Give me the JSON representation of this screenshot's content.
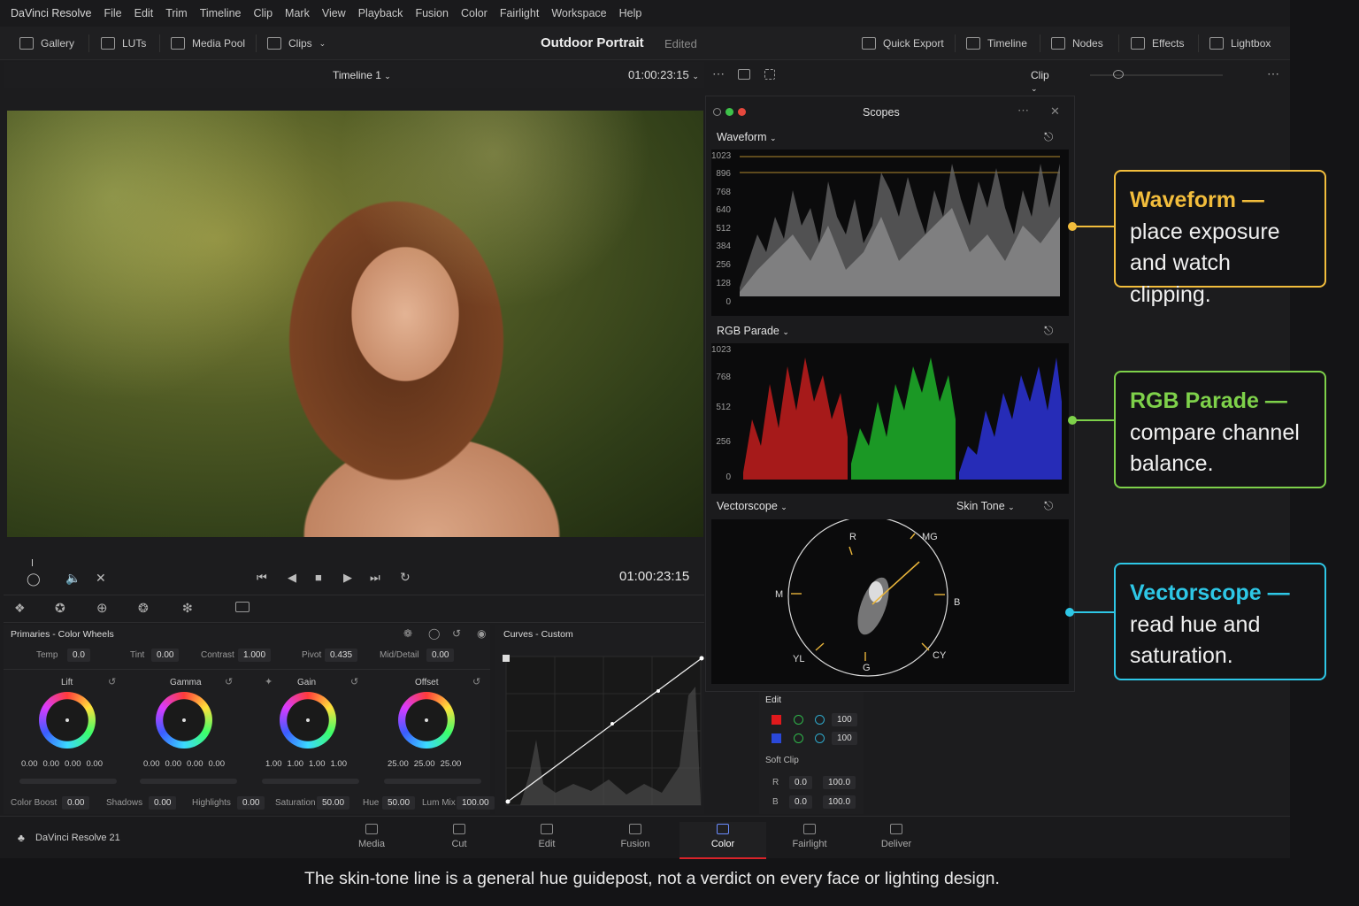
{
  "menubar": {
    "brand": "DaVinci Resolve",
    "items": [
      "File",
      "Edit",
      "Trim",
      "Timeline",
      "Clip",
      "Mark",
      "View",
      "Playback",
      "Fusion",
      "Color",
      "Fairlight",
      "Workspace",
      "Help"
    ]
  },
  "toolbar": {
    "left": [
      "Gallery",
      "LUTs",
      "Media Pool",
      "Clips"
    ],
    "project_title": "Outdoor Portrait",
    "project_state": "Edited",
    "right": [
      "Quick Export",
      "Timeline",
      "Nodes",
      "Effects",
      "Lightbox"
    ]
  },
  "viewer": {
    "timeline_name": "Timeline 1",
    "timecode": "01:00:23:15",
    "clip_mode": "Clip"
  },
  "transport": {
    "timecode": "01:00:23:15"
  },
  "primaries": {
    "title": "Primaries - Color Wheels",
    "top_params": [
      {
        "label": "Temp",
        "value": "0.0"
      },
      {
        "label": "Tint",
        "value": "0.00"
      },
      {
        "label": "Contrast",
        "value": "1.000"
      },
      {
        "label": "Pivot",
        "value": "0.435"
      },
      {
        "label": "Mid/Detail",
        "value": "0.00"
      }
    ],
    "wheels": [
      {
        "name": "Lift",
        "values": [
          "0.00",
          "0.00",
          "0.00",
          "0.00"
        ]
      },
      {
        "name": "Gamma",
        "values": [
          "0.00",
          "0.00",
          "0.00",
          "0.00"
        ]
      },
      {
        "name": "Gain",
        "values": [
          "1.00",
          "1.00",
          "1.00",
          "1.00"
        ]
      },
      {
        "name": "Offset",
        "values": [
          "25.00",
          "25.00",
          "25.00"
        ]
      }
    ],
    "bottom_params": [
      {
        "label": "Color Boost",
        "value": "0.00"
      },
      {
        "label": "Shadows",
        "value": "0.00"
      },
      {
        "label": "Highlights",
        "value": "0.00"
      },
      {
        "label": "Saturation",
        "value": "50.00"
      },
      {
        "label": "Hue",
        "value": "50.00"
      },
      {
        "label": "Lum Mix",
        "value": "100.00"
      }
    ]
  },
  "curves": {
    "title": "Curves - Custom"
  },
  "scopes": {
    "title": "Scopes",
    "waveform": {
      "label": "Waveform",
      "scale": [
        "1023",
        "896",
        "768",
        "640",
        "512",
        "384",
        "256",
        "128",
        "0"
      ]
    },
    "parade": {
      "label": "RGB Parade",
      "scale": [
        "1023",
        "768",
        "512",
        "256",
        "0"
      ]
    },
    "vectorscope": {
      "label": "Vectorscope",
      "mode": "Skin Tone",
      "targets": [
        "R",
        "MG",
        "M",
        "B",
        "YL",
        "CY",
        "G"
      ]
    }
  },
  "edit_panel": {
    "title": "Edit",
    "rows": [
      "100",
      "100"
    ],
    "softclip_title": "Soft Clip",
    "softclip": [
      {
        "ch": "R",
        "a": "0.0",
        "b": "100.0"
      },
      {
        "ch": "B",
        "a": "0.0",
        "b": "100.0"
      }
    ]
  },
  "bottom_nav": {
    "brand": "DaVinci Resolve 21",
    "items": [
      "Media",
      "Cut",
      "Edit",
      "Fusion",
      "Color",
      "Fairlight",
      "Deliver"
    ],
    "active": "Color"
  },
  "callouts": [
    {
      "title": "Waveform —",
      "body": "place exposure and watch clipping.",
      "color": "#f2bd3c"
    },
    {
      "title": "RGB Parade —",
      "body": "compare channel balance.",
      "color": "#7ed14a"
    },
    {
      "title": "Vectorscope —",
      "body": "read hue and saturation.",
      "color": "#2ec7e6"
    }
  ],
  "caption": "The skin-tone line is a general hue guidepost, not a verdict on every face or lighting design."
}
